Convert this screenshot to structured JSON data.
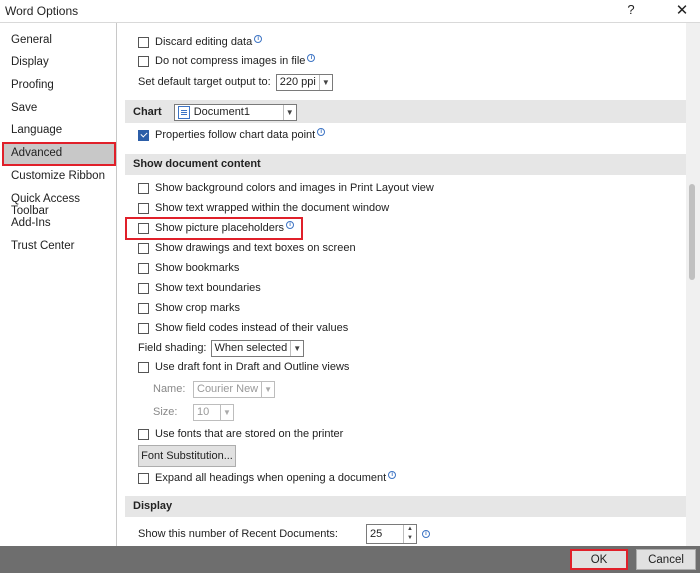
{
  "window": {
    "title": "Word Options",
    "help": "?",
    "close": "✕"
  },
  "sidebar": {
    "items": [
      {
        "label": "General"
      },
      {
        "label": "Display"
      },
      {
        "label": "Proofing"
      },
      {
        "label": "Save"
      },
      {
        "label": "Language"
      },
      {
        "label": "Advanced",
        "selected": true
      },
      {
        "label": "Customize Ribbon"
      },
      {
        "label": "Quick Access Toolbar"
      },
      {
        "label": "Add-Ins"
      },
      {
        "label": "Trust Center"
      }
    ]
  },
  "image_options": {
    "discard_editing_data": {
      "label": "Discard editing data",
      "checked": false
    },
    "do_not_compress": {
      "label": "Do not compress images in file",
      "checked": false
    },
    "default_output_label": "Set default target output to:",
    "default_output_value": "220 ppi"
  },
  "chart": {
    "section_label": "Chart",
    "document_value": "Document1",
    "properties_follow": {
      "label": "Properties follow chart data point",
      "checked": true
    }
  },
  "show_document_content": {
    "header": "Show document content",
    "items": [
      {
        "label": "Show background colors and images in Print Layout view",
        "checked": false
      },
      {
        "label": "Show text wrapped within the document window",
        "checked": false
      },
      {
        "label": "Show picture placeholders",
        "checked": false
      },
      {
        "label": "Show drawings and text boxes on screen",
        "checked": false
      },
      {
        "label": "Show bookmarks",
        "checked": false
      },
      {
        "label": "Show text boundaries",
        "checked": false
      },
      {
        "label": "Show crop marks",
        "checked": false
      },
      {
        "label": "Show field codes instead of their values",
        "checked": false
      }
    ],
    "field_shading_label": "Field shading:",
    "field_shading_value": "When selected",
    "draft_font": {
      "label": "Use draft font in Draft and Outline views",
      "checked": false
    },
    "name_label": "Name:",
    "name_value": "Courier New",
    "size_label": "Size:",
    "size_value": "10",
    "printer_fonts": {
      "label": "Use fonts that are stored on the printer",
      "checked": false
    },
    "font_substitution_button": "Font Substitution...",
    "expand_headings": {
      "label": "Expand all headings when opening a document",
      "checked": false
    }
  },
  "display": {
    "header": "Display",
    "recent_docs_label": "Show this number of Recent Documents:",
    "recent_docs_value": "25"
  },
  "footer": {
    "ok": "OK",
    "cancel": "Cancel"
  },
  "colors": {
    "highlight": "#e0202a",
    "checkbox_checked": "#2c5ea8",
    "footer_bg": "#6e6e6e"
  }
}
